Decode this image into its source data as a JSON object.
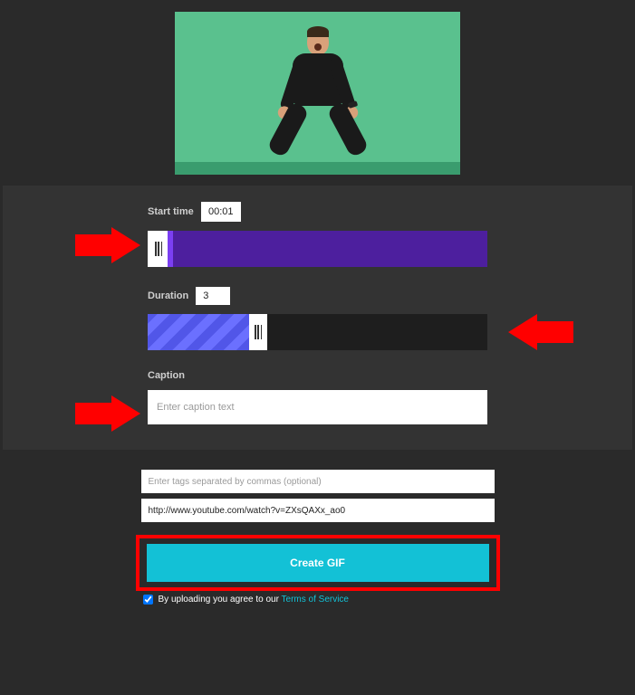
{
  "startTime": {
    "label": "Start time",
    "value": "00:01"
  },
  "duration": {
    "label": "Duration",
    "value": "3"
  },
  "caption": {
    "label": "Caption",
    "placeholder": "Enter caption text",
    "value": ""
  },
  "tags": {
    "placeholder": "Enter tags separated by commas (optional)",
    "value": ""
  },
  "sourceUrl": {
    "value": "http://www.youtube.com/watch?v=ZXsQAXx_ao0"
  },
  "createButton": {
    "label": "Create GIF"
  },
  "agreement": {
    "checked": true,
    "textPrefix": "By uploading you agree to our ",
    "linkText": "Terms of Service"
  }
}
